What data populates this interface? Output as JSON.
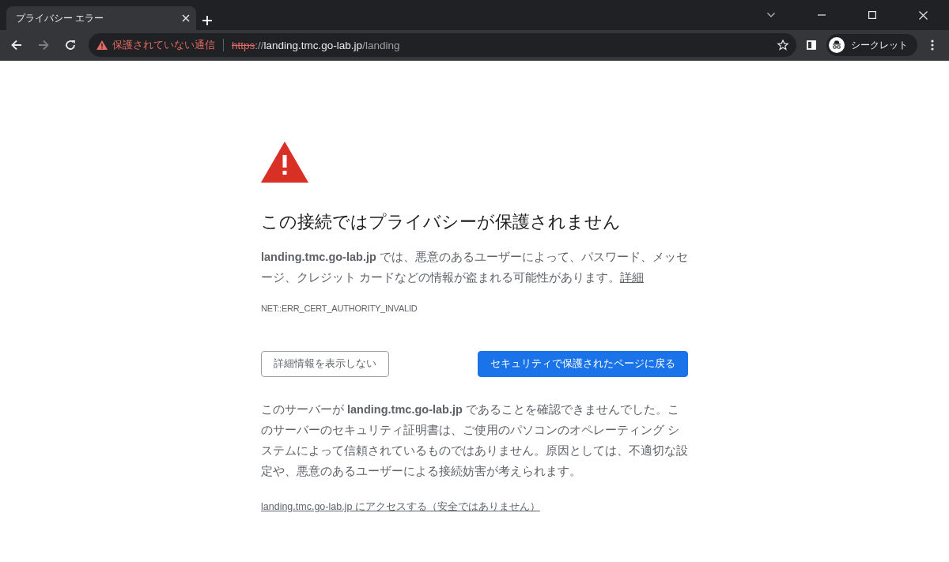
{
  "tab": {
    "title": "プライバシー エラー",
    "selected": true
  },
  "toolbar": {
    "security_label": "保護されていない通信",
    "url_parts": [
      {
        "kind": "scheme",
        "text": "https"
      },
      {
        "kind": "sep",
        "text": "://"
      },
      {
        "kind": "host",
        "text": "landing.tmc.go-lab.jp"
      },
      {
        "kind": "path",
        "text": "/landing"
      }
    ],
    "profile_label": "シークレット"
  },
  "page": {
    "heading": "この接続ではプライバシーが保護されません",
    "warning": {
      "text": "**landing.tmc.go-lab.jp** では、悪意のあるユーザーによって、パスワード、メッセージ、クレジット カードなどの情報が盗まれる可能性があります。",
      "link": "詳細"
    },
    "error_code": "NET::ERR_CERT_AUTHORITY_INVALID",
    "buttons": [
      {
        "kind": "secondary",
        "label": "詳細情報を表示しない"
      },
      {
        "kind": "primary",
        "label": "セキュリティで保護されたページに戻る"
      }
    ],
    "details": "このサーバーが **landing.tmc.go-lab.jp** であることを確認できませんでした。このサーバーのセキュリティ証明書は、ご使用のパソコンのオペレーティング システムによって信頼されているものではありません。原因としては、不適切な設定や、悪意のあるユーザーによる接続妨害が考えられます。",
    "proceed_link": "landing.tmc.go-lab.jp にアクセスする（安全ではありません）"
  }
}
